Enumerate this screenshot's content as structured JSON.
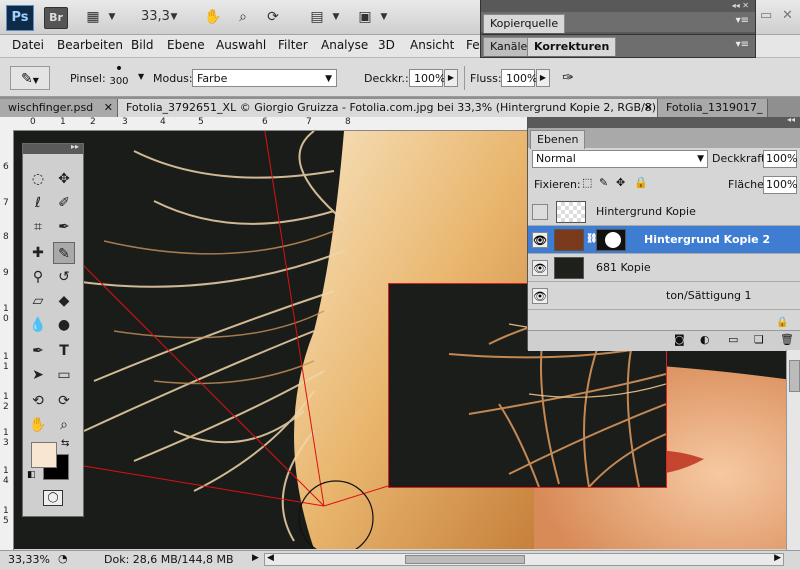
{
  "app": {
    "logo": "Ps",
    "bridge": "Br",
    "zoom": "33,3"
  },
  "panels": {
    "kopierquelle": "Kopierquelle",
    "kanaele": "Kanäle",
    "korrekturen": "Korrekturen"
  },
  "menu": [
    "Datei",
    "Bearbeiten",
    "Bild",
    "Ebene",
    "Auswahl",
    "Filter",
    "Analyse",
    "3D",
    "Ansicht",
    "Fe"
  ],
  "options": {
    "pinsel_label": "Pinsel:",
    "pinsel_size": "300",
    "modus_label": "Modus:",
    "modus_value": "Farbe",
    "deckkr_label": "Deckkr.:",
    "deckkr_value": "100%",
    "fluss_label": "Fluss:",
    "fluss_value": "100%"
  },
  "doc_tabs": [
    "wischfinger.psd",
    "Fotolia_3792651_XL © Giorgio Gruizza - Fotolia.com.jpg bei 33,3% (Hintergrund Kopie 2, RGB/8) *",
    "Fotolia_1319017_"
  ],
  "ruler_top": [
    "0",
    "1",
    "2",
    "3",
    "4",
    "5",
    "6",
    "7",
    "8"
  ],
  "ruler_left": [
    "6",
    "7",
    "8",
    "9",
    "1 0",
    "1 1",
    "1 2",
    "1 3",
    "1 4",
    "1 5"
  ],
  "layers": {
    "title": "Ebenen",
    "blend": "Normal",
    "deckkraft_label": "Deckkraft:",
    "deckkraft_value": "100%",
    "fixieren_label": "Fixieren:",
    "flaeche_label": "Fläche:",
    "flaeche_value": "100%",
    "items": [
      {
        "name": "Hintergrund Kopie",
        "visible": false,
        "active": false
      },
      {
        "name": "Hintergrund Kopie 2",
        "visible": true,
        "active": true
      },
      {
        "name": "681 Kopie",
        "visible": true,
        "active": false
      },
      {
        "name": "ton/Sättigung 1",
        "visible": true,
        "active": false
      }
    ]
  },
  "status": {
    "zoom": "33,33%",
    "doc": "Dok: 28,6 MB/144,8 MB"
  },
  "colors": {
    "foreground": "#f8e6d2",
    "background": "#000000",
    "selection": "#3f7dd3"
  }
}
